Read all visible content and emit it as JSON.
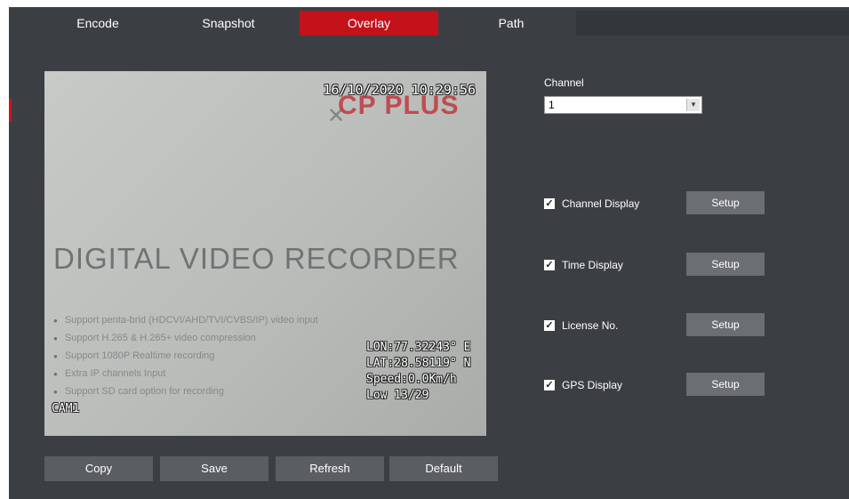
{
  "tabs": [
    {
      "label": "Encode",
      "active": false
    },
    {
      "label": "Snapshot",
      "active": false
    },
    {
      "label": "Overlay",
      "active": true
    },
    {
      "label": "Path",
      "active": false
    }
  ],
  "preview": {
    "osd_time": "16/10/2020 10:29:56",
    "logo_text": "CP PLUS",
    "title_text": "DIGITAL VIDEO RECORDER",
    "feature_lines": [
      "Support penta-brid (HDCVI/AHD/TVI/CVBS/IP) video input",
      "Support H.265 & H.265+ video compression",
      "Support 1080P Realtime recording",
      "Extra IP channels Input",
      "Support SD card option for recording"
    ],
    "gps_lon": "LON:77.32243° E",
    "gps_lat": "LAT:28.58119° N",
    "gps_speed": "Speed:0.0Km/h",
    "gps_low": "Low 13/29",
    "camera_name": "CAM1"
  },
  "buttons": {
    "copy": "Copy",
    "save": "Save",
    "refresh": "Refresh",
    "default": "Default"
  },
  "channel": {
    "label": "Channel",
    "value": "1"
  },
  "options": [
    {
      "label": "Channel Display",
      "checked": true,
      "setup": "Setup"
    },
    {
      "label": "Time Display",
      "checked": true,
      "setup": "Setup"
    },
    {
      "label": "License No.",
      "checked": true,
      "setup": "Setup"
    },
    {
      "label": "GPS Display",
      "checked": true,
      "setup": "Setup"
    }
  ],
  "colors": {
    "accent": "#c4121b",
    "panel": "#3b3f44",
    "button": "#5a5e63"
  }
}
